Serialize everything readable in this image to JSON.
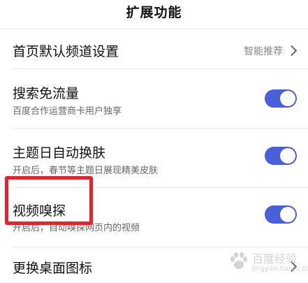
{
  "header": {
    "title": "扩展功能"
  },
  "rows": [
    {
      "title": "首页默认频道设置",
      "value": "智能推荐"
    },
    {
      "title": "搜索免流量",
      "subtitle": "百度合作运营商卡用户独享",
      "toggle_on": true
    },
    {
      "title": "主题日自动换肤",
      "subtitle": "开启后，春节等主题日展现精美皮肤",
      "toggle_on": true
    },
    {
      "title": "视频嗅探",
      "subtitle": "开启后，自动嗅探网页内的视频",
      "toggle_on": true
    },
    {
      "title": "更换桌面图标"
    }
  ],
  "watermark": {
    "text": "百度经验",
    "url": "jingyan.baidu.com"
  },
  "colors": {
    "toggle_on": "#4a5fdb",
    "highlight": "#e8212a",
    "divider": "#e9e9e9"
  },
  "icons": {
    "chevron": "chevron-right-icon",
    "watermark": "paw-icon"
  }
}
